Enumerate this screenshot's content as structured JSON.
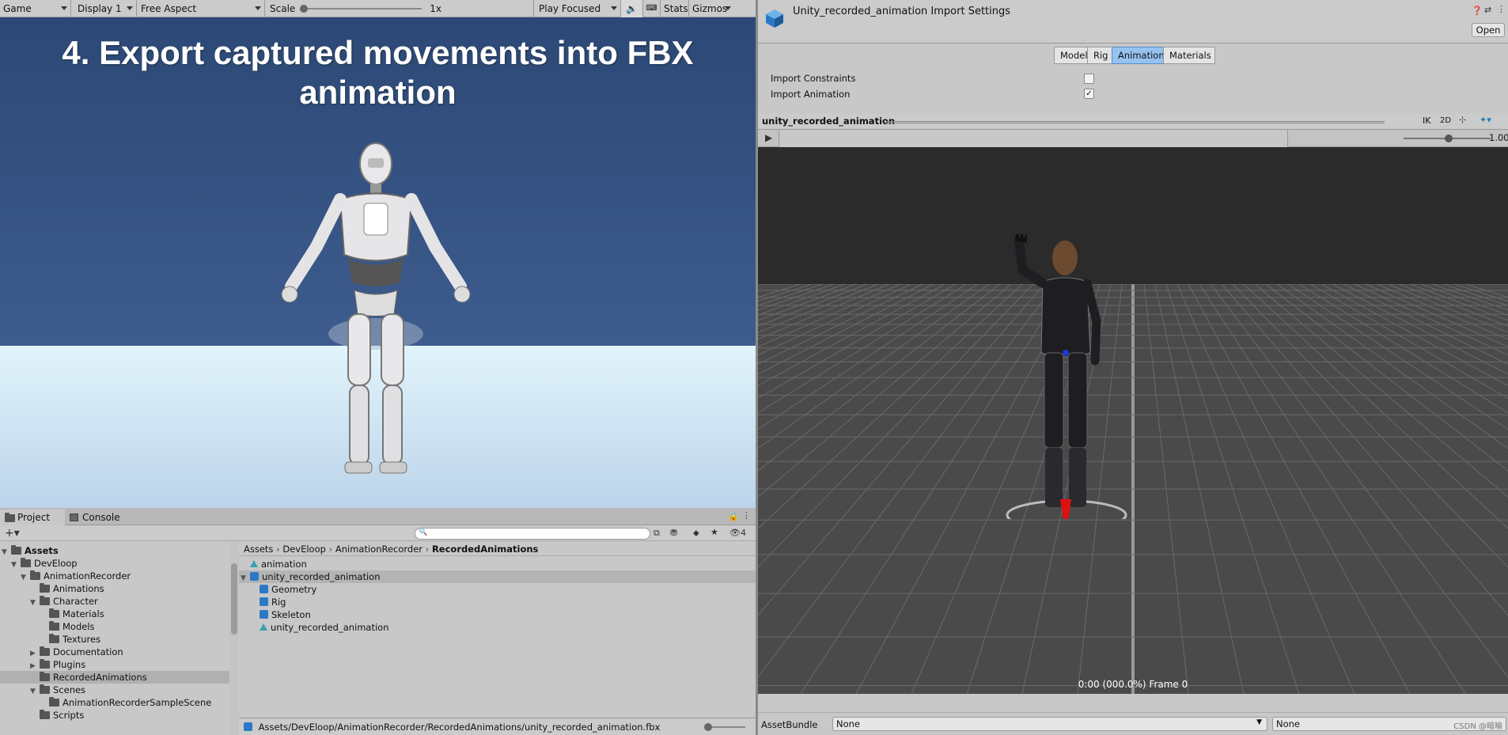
{
  "game": {
    "tab_label": "Game",
    "display": "Display 1",
    "aspect": "Free Aspect",
    "scale_label": "Scale",
    "scale_value": "1x",
    "play_mode": "Play Focused",
    "stats": "Stats",
    "gizmos": "Gizmos",
    "title_line1": "4. Export captured movements into FBX",
    "title_line2": "animation"
  },
  "project": {
    "tabs": [
      "Project",
      "Console"
    ],
    "hidden_count": "4",
    "tree": [
      {
        "label": "Assets",
        "depth": 0,
        "expanded": true,
        "bold": true
      },
      {
        "label": "DevEloop",
        "depth": 1,
        "expanded": true
      },
      {
        "label": "AnimationRecorder",
        "depth": 2,
        "expanded": true
      },
      {
        "label": "Animations",
        "depth": 3
      },
      {
        "label": "Character",
        "depth": 3,
        "expanded": true
      },
      {
        "label": "Materials",
        "depth": 4
      },
      {
        "label": "Models",
        "depth": 4
      },
      {
        "label": "Textures",
        "depth": 4
      },
      {
        "label": "Documentation",
        "depth": 3,
        "collapsed": true
      },
      {
        "label": "Plugins",
        "depth": 3,
        "collapsed": true
      },
      {
        "label": "RecordedAnimations",
        "depth": 3,
        "selected": true
      },
      {
        "label": "Scenes",
        "depth": 3,
        "expanded": true
      },
      {
        "label": "AnimationRecorderSampleScene",
        "depth": 4
      },
      {
        "label": "Scripts",
        "depth": 3
      }
    ],
    "breadcrumb": [
      "Assets",
      "DevEloop",
      "AnimationRecorder",
      "RecordedAnimations"
    ],
    "files": [
      {
        "label": "animation",
        "icon": "animation-clip-icon",
        "depth": 0
      },
      {
        "label": "unity_recorded_animation",
        "icon": "model-icon",
        "depth": 0,
        "expanded": true,
        "selected": true
      },
      {
        "label": "Geometry",
        "icon": "mesh-icon",
        "depth": 1
      },
      {
        "label": "Rig",
        "icon": "mesh-icon",
        "depth": 1
      },
      {
        "label": "Skeleton",
        "icon": "mesh-icon",
        "depth": 1
      },
      {
        "label": "unity_recorded_animation",
        "icon": "animation-clip-icon",
        "depth": 1
      }
    ],
    "path": "Assets/DevEloop/AnimationRecorder/RecordedAnimations/unity_recorded_animation.fbx"
  },
  "inspector": {
    "title": "Unity_recorded_animation Import Settings",
    "open_button": "Open",
    "tabs": [
      "Model",
      "Rig",
      "Animation",
      "Materials"
    ],
    "active_tab": "Animation",
    "import_constraints_label": "Import Constraints",
    "import_constraints_checked": false,
    "import_animation_label": "Import Animation",
    "import_animation_checked": true,
    "check_mark": "✓",
    "preview_name": "unity_recorded_animation",
    "preview_ik": "IK",
    "preview_2d": "2D",
    "speed": "1.00",
    "time_readout": "0:00 (000.0%) Frame 0",
    "assetbundle_label": "AssetBundle",
    "assetbundle_value": "None",
    "assetbundle_variant": "None",
    "watermark": "CSDN @暗喻"
  },
  "colors": {
    "active_tab": "#96c2f0",
    "sky": "#2e4a78"
  }
}
